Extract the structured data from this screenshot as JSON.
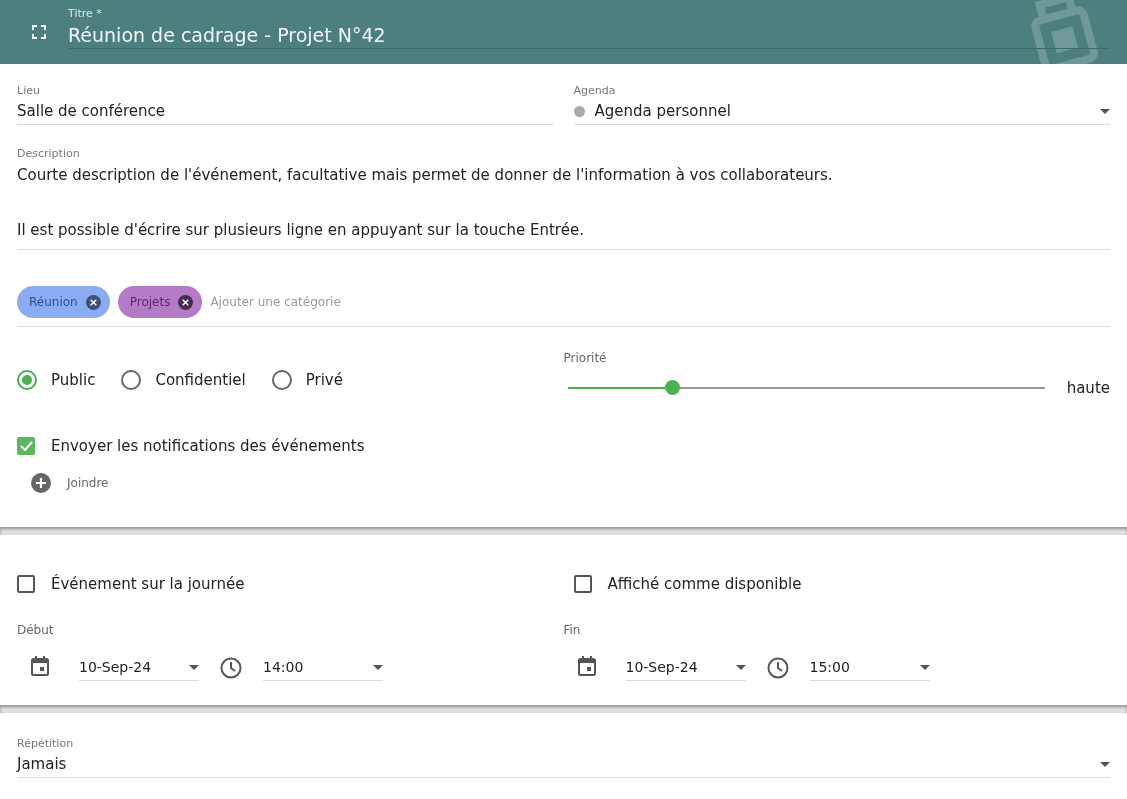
{
  "header": {
    "label": "Titre *",
    "value": "Réunion de cadrage - Projet N°42"
  },
  "location": {
    "label": "Lieu",
    "value": "Salle de conférence"
  },
  "calendar": {
    "label": "Agenda",
    "value": "Agenda personnel",
    "color": "#aaaaaa"
  },
  "description": {
    "label": "Description",
    "paragraphs": [
      "Courte description de l'événement, facultative mais permet de donner de l'information à vos collaborateurs.",
      "Il est possible d'écrire sur plusieurs ligne en appuyant sur la touche Entrée."
    ]
  },
  "categories": {
    "chips": [
      {
        "label": "Réunion",
        "color": "#8cacf2"
      },
      {
        "label": "Projets",
        "color": "#b47cc7"
      }
    ],
    "placeholder": "Ajouter une catégorie"
  },
  "visibility": [
    {
      "label": "Public",
      "selected": true
    },
    {
      "label": "Confidentiel",
      "selected": false
    },
    {
      "label": "Privé",
      "selected": false
    }
  ],
  "priority": {
    "label": "Priorité",
    "level": 0.22,
    "reading": "haute"
  },
  "notifications": {
    "label": "Envoyer les notifications des événements",
    "checked": true
  },
  "attach": {
    "label": "Joindre"
  },
  "all_day": {
    "label": "Événement sur la journée",
    "checked": false
  },
  "show_free": {
    "label": "Affiché comme disponible",
    "checked": false
  },
  "start": {
    "label": "Début",
    "date": "10-Sep-24",
    "time": "14:00"
  },
  "end": {
    "label": "Fin",
    "date": "10-Sep-24",
    "time": "15:00"
  },
  "repeat": {
    "label": "Répétition",
    "value": "Jamais"
  }
}
